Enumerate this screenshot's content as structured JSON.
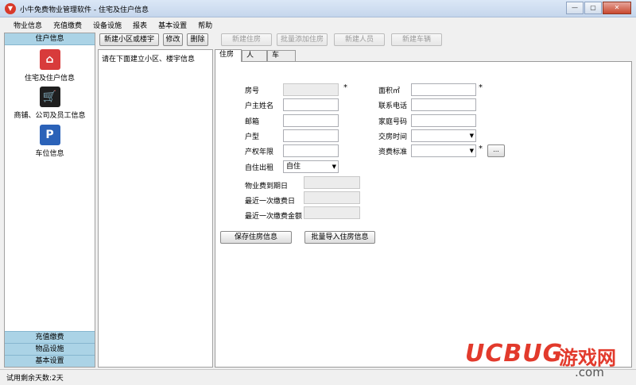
{
  "window": {
    "title": "小牛免费物业管理软件 - 住宅及住户信息",
    "app_icon": "app-logo-icon",
    "controls": [
      "minimize-icon",
      "maximize-icon",
      "close-icon"
    ]
  },
  "menu": [
    {
      "label": "物业信息"
    },
    {
      "label": "充值缴费"
    },
    {
      "label": "设备设施"
    },
    {
      "label": "报表"
    },
    {
      "label": "基本设置"
    },
    {
      "label": "帮助"
    }
  ],
  "sidebar": {
    "header": "住户信息",
    "items": [
      {
        "label": "住宅及住户信息",
        "icon": "house-icon",
        "color": "#d83b3b"
      },
      {
        "label": "商铺、公司及员工信息",
        "icon": "shopping-cart-icon",
        "color": "#1f1f1f"
      },
      {
        "label": "车位信息",
        "icon": "parking-icon",
        "color": "#2b62b8"
      }
    ],
    "bottom_items": [
      {
        "label": "充值缴费"
      },
      {
        "label": "物品设施"
      },
      {
        "label": "基本设置"
      }
    ]
  },
  "toolbar": {
    "new_community": "新建小区或楼宇",
    "edit": "修改",
    "delete": "删除",
    "new_house": "新建住房",
    "batch_add_house": "批量添加住房",
    "new_person": "新建人员",
    "new_vehicle": "新建车辆"
  },
  "tree_hint": "请在下面建立小区、楼宇信息",
  "tabs": [
    {
      "label": "住房",
      "active": true
    },
    {
      "label": "人",
      "active": false
    },
    {
      "label": "车",
      "active": false
    }
  ],
  "form": {
    "room_no": "房号",
    "owner_name": "户主姓名",
    "email": "邮箱",
    "house_type": "户型",
    "property_years": "产权年限",
    "self_or_rent": "自住出租",
    "self_or_rent_value": "自住",
    "area": "面积㎡",
    "phone": "联系电话",
    "home_phone": "家庭号码",
    "handover_time": "交房时间",
    "fee_standard": "资费标准",
    "fee_due": "物业费到期日",
    "last_pay_date": "最近一次缴费日",
    "last_pay_amount": "最近一次缴费金额",
    "required_mark": "*",
    "ellipsis": "..."
  },
  "actions": {
    "save": "保存住房信息",
    "batch_import": "批量导入住房信息"
  },
  "status": {
    "trial_days": "试用剩余天数:2天"
  },
  "watermark": {
    "brand": "UCBUG",
    "cn": "游戏网",
    "domain": ".com"
  },
  "colors": {
    "sidebar_header": "#abd3e6",
    "watermark_red": "#e23a2c"
  }
}
